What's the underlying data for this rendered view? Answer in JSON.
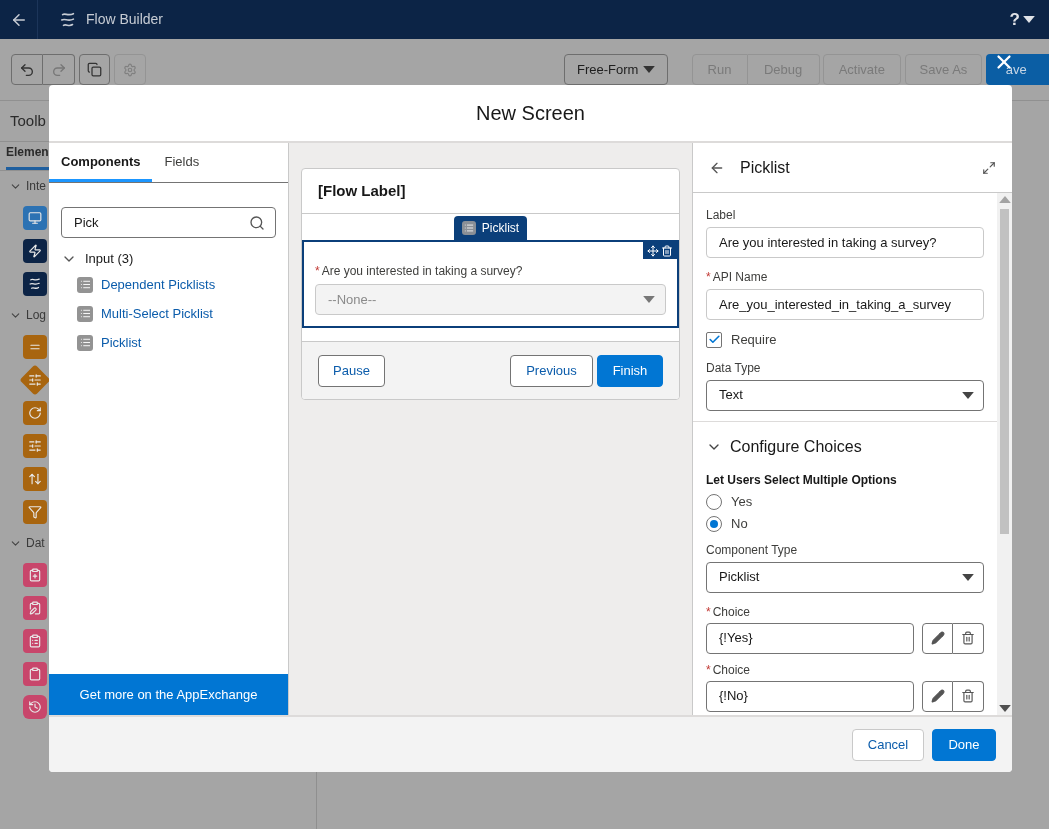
{
  "app_bar": {
    "title": "Flow Builder",
    "help": "?"
  },
  "toolbar": {
    "layout": "Free-Form",
    "buttons": [
      {
        "label": "Run"
      },
      {
        "label": "Debug"
      },
      {
        "label": "Activate"
      },
      {
        "label": "Save As"
      },
      {
        "label": "ave"
      }
    ]
  },
  "toolbox": {
    "title": "Toolb",
    "tab": "Elemen",
    "sections": [
      {
        "label": "Inte",
        "items": [
          {
            "kind": "square",
            "color": "#2c72b3"
          },
          {
            "kind": "square",
            "color": "#0c2446"
          },
          {
            "kind": "square",
            "color": "#0c2446"
          }
        ]
      },
      {
        "label": "Log",
        "items": [
          {
            "kind": "square",
            "color": "#a8650f"
          },
          {
            "kind": "diamond",
            "color": "#a8650f"
          },
          {
            "kind": "square",
            "color": "#a8650f"
          },
          {
            "kind": "square",
            "color": "#a8650f"
          },
          {
            "kind": "square",
            "color": "#a8650f"
          },
          {
            "kind": "square",
            "color": "#a8650f"
          }
        ]
      },
      {
        "label": "Dat",
        "items": [
          {
            "kind": "square",
            "color": "#c8466b"
          },
          {
            "kind": "square",
            "color": "#c8466b"
          },
          {
            "kind": "square",
            "color": "#c8466b"
          },
          {
            "kind": "square",
            "color": "#c8466b"
          },
          {
            "kind": "round",
            "color": "#c8466b"
          }
        ]
      }
    ]
  },
  "modal": {
    "title": "New Screen",
    "palette": {
      "tabs": [
        {
          "label": "Components",
          "selected": true
        },
        {
          "label": "Fields",
          "selected": false
        }
      ],
      "search": {
        "value": "Pick"
      },
      "group": {
        "label": "Input (3)",
        "expanded": true,
        "children": [
          {
            "label": "Dependent Picklists"
          },
          {
            "label": "Multi-Select Picklist"
          },
          {
            "label": "Picklist"
          }
        ]
      },
      "footer_link": "Get more on the AppExchange"
    },
    "canvas": {
      "header": "[Flow Label]",
      "component_tab": "Picklist",
      "field": {
        "label": "Are you interested in taking a survey?",
        "required_mark": "*",
        "placeholder": "--None--"
      },
      "buttons": [
        {
          "label": "Pause",
          "kind": "outline"
        },
        {
          "label": "Previous",
          "kind": "outline"
        },
        {
          "label": "Finish",
          "kind": "brand"
        }
      ]
    },
    "properties": {
      "title": "Picklist",
      "fields": [
        {
          "kind": "text",
          "label": "Label",
          "value": "Are you interested in taking a survey?"
        },
        {
          "kind": "text",
          "label": "API Name",
          "required_mark": "*",
          "value": "Are_you_interested_in_taking_a_survey"
        },
        {
          "kind": "checkbox",
          "label": "Require",
          "checked": true
        },
        {
          "kind": "select",
          "label": "Data Type",
          "value": "Text"
        },
        {
          "kind": "section",
          "label": "Configure Choices",
          "expanded": true
        },
        {
          "kind": "radio",
          "label": "Let Users Select Multiple Options",
          "options": [
            {
              "label": "Yes",
              "selected": false
            },
            {
              "label": "No",
              "selected": true
            }
          ]
        },
        {
          "kind": "select",
          "label": "Component Type",
          "value": "Picklist"
        },
        {
          "kind": "choice",
          "label": "Choice",
          "required_mark": "*",
          "value": "{!Yes}"
        },
        {
          "kind": "choice",
          "label": "Choice",
          "required_mark": "*",
          "value": "{!No}"
        }
      ]
    },
    "footer": [
      {
        "label": "Cancel",
        "kind": "outline"
      },
      {
        "label": "Done",
        "kind": "brand"
      }
    ]
  }
}
